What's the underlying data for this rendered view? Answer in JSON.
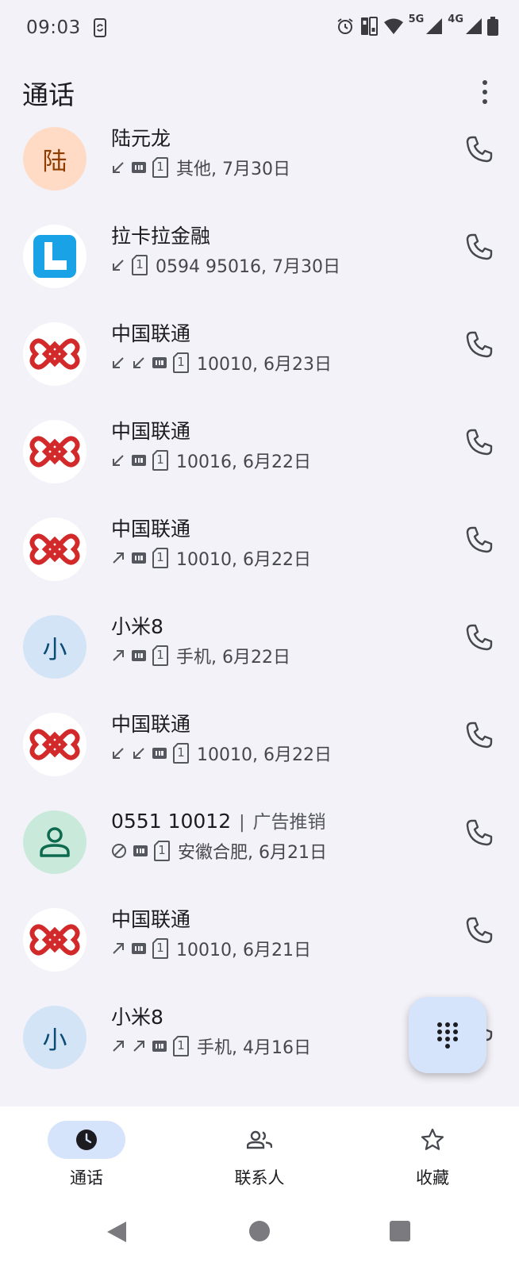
{
  "status_bar": {
    "time": "09:03",
    "network_5g": "5G",
    "network_4g": "4G"
  },
  "header": {
    "title": "通话"
  },
  "calls": [
    {
      "name": "陆元龙",
      "tag": "",
      "avatar_type": "letter",
      "avatar_letter": "陆",
      "avatar_color": "orange",
      "directions": [
        "incoming"
      ],
      "hd": true,
      "sim": "1",
      "detail": "其他, 7月30日"
    },
    {
      "name": "拉卡拉金融",
      "tag": "",
      "avatar_type": "lakala",
      "avatar_letter": "",
      "avatar_color": "",
      "directions": [
        "incoming"
      ],
      "hd": false,
      "sim": "1",
      "detail": "0594 95016, 7月30日"
    },
    {
      "name": "中国联通",
      "tag": "",
      "avatar_type": "unicom",
      "avatar_letter": "",
      "avatar_color": "",
      "directions": [
        "incoming",
        "incoming"
      ],
      "hd": true,
      "sim": "1",
      "detail": "10010, 6月23日"
    },
    {
      "name": "中国联通",
      "tag": "",
      "avatar_type": "unicom",
      "avatar_letter": "",
      "avatar_color": "",
      "directions": [
        "incoming"
      ],
      "hd": true,
      "sim": "1",
      "detail": "10016, 6月22日"
    },
    {
      "name": "中国联通",
      "tag": "",
      "avatar_type": "unicom",
      "avatar_letter": "",
      "avatar_color": "",
      "directions": [
        "outgoing"
      ],
      "hd": true,
      "sim": "1",
      "detail": "10010, 6月22日"
    },
    {
      "name": "小米8",
      "tag": "",
      "avatar_type": "letter",
      "avatar_letter": "小",
      "avatar_color": "blue",
      "directions": [
        "outgoing"
      ],
      "hd": true,
      "sim": "1",
      "detail": "手机, 6月22日"
    },
    {
      "name": "中国联通",
      "tag": "",
      "avatar_type": "unicom",
      "avatar_letter": "",
      "avatar_color": "",
      "directions": [
        "incoming",
        "incoming"
      ],
      "hd": true,
      "sim": "1",
      "detail": "10010, 6月22日"
    },
    {
      "name": "0551 10012",
      "tag": "广告推销",
      "avatar_type": "person",
      "avatar_letter": "",
      "avatar_color": "",
      "directions": [
        "blocked"
      ],
      "hd": true,
      "sim": "1",
      "detail": "安徽合肥, 6月21日"
    },
    {
      "name": "中国联通",
      "tag": "",
      "avatar_type": "unicom",
      "avatar_letter": "",
      "avatar_color": "",
      "directions": [
        "outgoing"
      ],
      "hd": true,
      "sim": "1",
      "detail": "10010, 6月21日"
    },
    {
      "name": "小米8",
      "tag": "",
      "avatar_type": "letter",
      "avatar_letter": "小",
      "avatar_color": "blue",
      "directions": [
        "outgoing",
        "outgoing"
      ],
      "hd": true,
      "sim": "1",
      "detail": "手机, 4月16日"
    }
  ],
  "separator": "|",
  "bottom_nav": [
    {
      "label": "通话",
      "icon": "clock-icon",
      "active": true
    },
    {
      "label": "联系人",
      "icon": "people-icon",
      "active": false
    },
    {
      "label": "收藏",
      "icon": "star-icon",
      "active": false
    }
  ],
  "colors": {
    "background": "#f3f2f8",
    "accent_container": "#d5e3fb",
    "unicom_red": "#d22a2a",
    "lakala_blue": "#19a3e6"
  }
}
